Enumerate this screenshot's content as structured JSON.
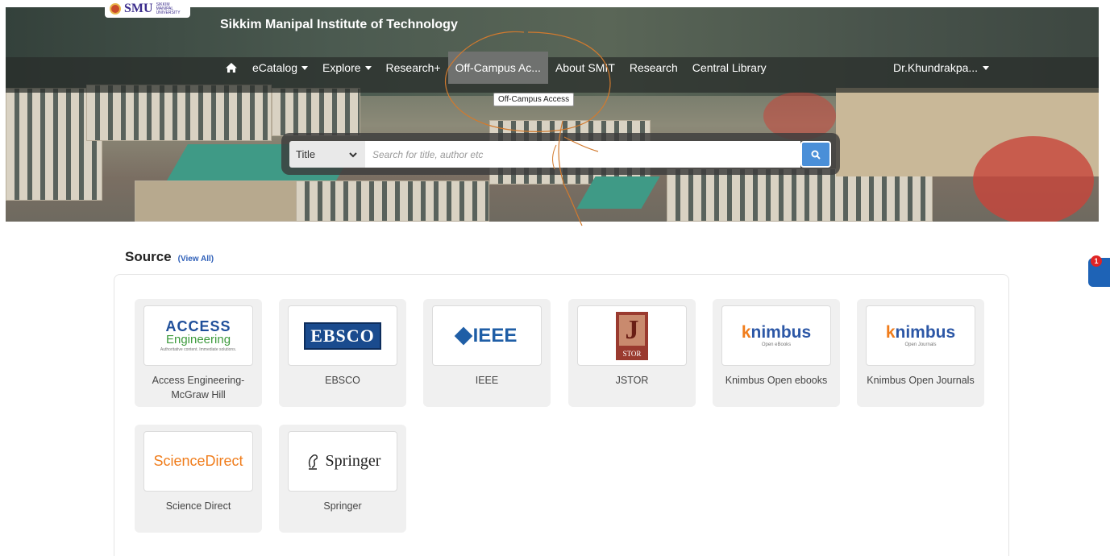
{
  "header": {
    "logo_text": "SMU",
    "logo_subtext": "SIKKIM MANIPAL UNIVERSITY",
    "site_title": "Sikkim Manipal Institute of Technology"
  },
  "nav": {
    "items": [
      {
        "label": "eCatalog",
        "dropdown": true
      },
      {
        "label": "Explore",
        "dropdown": true
      },
      {
        "label": "Research+",
        "dropdown": false
      },
      {
        "label": "Off-Campus Ac...",
        "dropdown": false,
        "active": true
      },
      {
        "label": "About SMIT",
        "dropdown": false
      },
      {
        "label": "Research",
        "dropdown": false
      },
      {
        "label": "Central Library",
        "dropdown": false
      }
    ],
    "user": "Dr.Khundrakpa...",
    "tooltip": "Off-Campus Access"
  },
  "search": {
    "type_selected": "Title",
    "placeholder": "Search for title, author etc"
  },
  "source": {
    "heading": "Source",
    "view_all": "(View All)",
    "cards": [
      {
        "name": "Access Engineering-McGraw Hill"
      },
      {
        "name": "EBSCO"
      },
      {
        "name": "IEEE"
      },
      {
        "name": "JSTOR"
      },
      {
        "name": "Knimbus Open ebooks"
      },
      {
        "name": "Knimbus Open Journals"
      },
      {
        "name": "Science Direct"
      },
      {
        "name": "Springer"
      }
    ]
  },
  "logos": {
    "access_top": "ACCESS",
    "access_mid": "Engineering",
    "access_tag": "Authoritative content. Immediate solutions.",
    "ebsco": "EBSCO",
    "ieee": "IEEE",
    "jstor_letter": "J",
    "jstor_word": "STOR",
    "knimbus_k": "k",
    "knimbus_rest": "nimbus",
    "knimbus_ebooks": "Open eBooks",
    "knimbus_journals": "Open Journals",
    "sciencedirect": "ScienceDirect",
    "springer": "Springer"
  },
  "side_badge": "1",
  "colors": {
    "nav_active": "#6f716f",
    "search_button": "#4a8fd8",
    "link": "#2e5fb8",
    "badge": "#e02424"
  }
}
